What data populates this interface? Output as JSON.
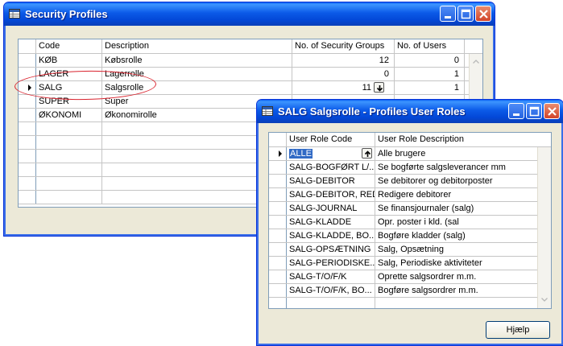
{
  "back_window": {
    "title": "Security Profiles",
    "columns": {
      "code": "Code",
      "description": "Description",
      "groups": "No. of Security Groups",
      "users": "No. of Users"
    },
    "rows": [
      {
        "code": "KØB",
        "description": "Købsrolle",
        "groups": "12",
        "users": "0"
      },
      {
        "code": "LAGER",
        "description": "Lagerrolle",
        "groups": "0",
        "users": "1"
      },
      {
        "code": "SALG",
        "description": "Salgsrolle",
        "groups": "11",
        "users": "1"
      },
      {
        "code": "SUPER",
        "description": "Super",
        "groups": "",
        "users": ""
      },
      {
        "code": "ØKONOMI",
        "description": "Økonomirolle",
        "groups": "",
        "users": ""
      }
    ],
    "selected_row": "SALG"
  },
  "front_window": {
    "title": "SALG Salgsrolle - Profiles User Roles",
    "columns": {
      "code": "User Role Code",
      "description": "User Role Description"
    },
    "rows": [
      {
        "code": "ALLE",
        "description": "Alle brugere"
      },
      {
        "code": "SALG-BOGFØRT L/...",
        "description": "Se bogførte salgsleverancer mm"
      },
      {
        "code": "SALG-DEBITOR",
        "description": "Se debitorer og debitorposter"
      },
      {
        "code": "SALG-DEBITOR, RED.",
        "description": "Redigere debitorer"
      },
      {
        "code": "SALG-JOURNAL",
        "description": "Se finansjournaler (salg)"
      },
      {
        "code": "SALG-KLADDE",
        "description": "Opr. poster i kld. (sal"
      },
      {
        "code": "SALG-KLADDE, BO...",
        "description": "Bogføre kladder (salg)"
      },
      {
        "code": "SALG-OPSÆTNING",
        "description": "Salg, Opsætning"
      },
      {
        "code": "SALG-PERIODISKE...",
        "description": "Salg, Periodiske aktiviteter"
      },
      {
        "code": "SALG-T/O/F/K",
        "description": "Oprette salgsordrer m.m."
      },
      {
        "code": "SALG-T/O/F/K, BO...",
        "description": "Bogføre salgsordrer m.m."
      }
    ],
    "help_button": "Hjælp"
  },
  "colors": {
    "title_blue": "#0348d7",
    "highlight": "#316ac5",
    "annotation_red": "#d9232e"
  },
  "icons": [
    "table-icon",
    "minimize-icon",
    "maximize-icon",
    "close-icon",
    "lookup-icon",
    "scroll-up-icon",
    "scroll-down-icon",
    "row-pointer-icon"
  ]
}
